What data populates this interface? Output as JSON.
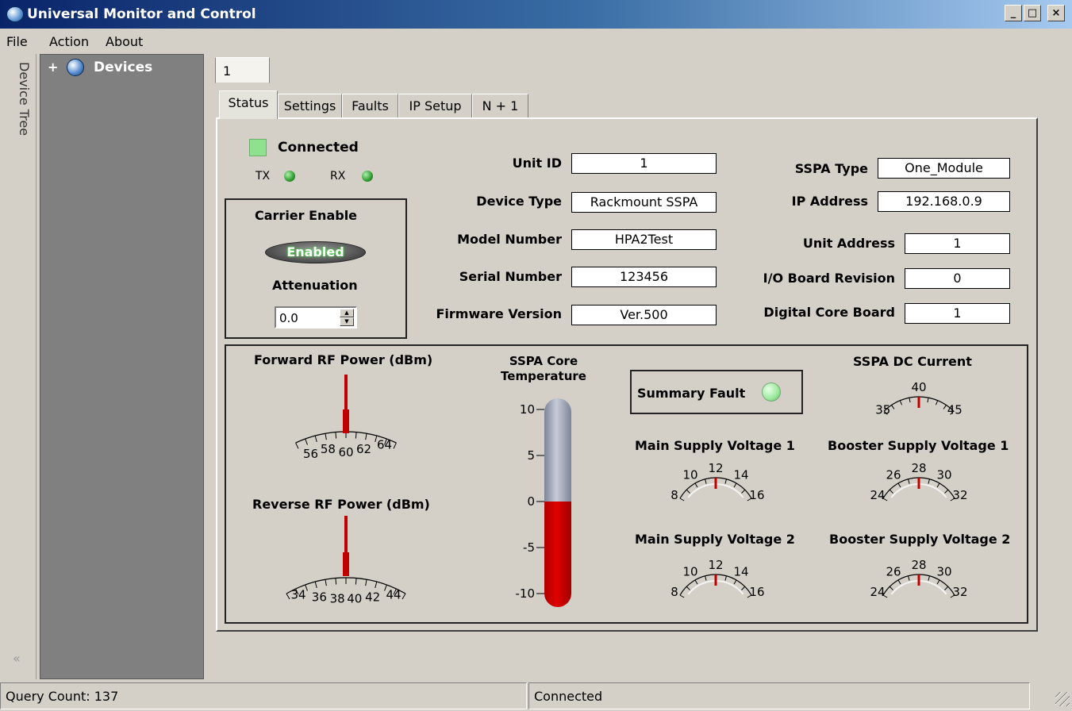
{
  "window": {
    "title": "Universal Monitor and Control",
    "controls": [
      "_",
      "□",
      "×"
    ]
  },
  "menu": {
    "file": "File",
    "action": "Action",
    "about": "About"
  },
  "sidebar": {
    "strip_label": "Device Tree",
    "collapse_glyph": "«",
    "tree_expander": "+",
    "tree_root": "Devices",
    "tree_icon": "globe-icon"
  },
  "unit_tab": {
    "label": "1"
  },
  "tabs": [
    {
      "label": "Status",
      "active": true
    },
    {
      "label": "Settings"
    },
    {
      "label": "Faults"
    },
    {
      "label": "IP Setup"
    },
    {
      "label": "N + 1"
    }
  ],
  "status": {
    "connected_label": "Connected",
    "tx_label": "TX",
    "rx_label": "RX",
    "connected_color": "#8fe08f",
    "led_color": "#2e9a2e"
  },
  "carrier": {
    "title": "Carrier Enable",
    "button_label": "Enabled",
    "attenuation_label": "Attenuation",
    "attenuation_value": "0.0"
  },
  "info_left": [
    {
      "label": "Unit ID",
      "value": "1"
    },
    {
      "label": "Device Type",
      "value": "Rackmount SSPA"
    },
    {
      "label": "Model Number",
      "value": "HPA2Test"
    },
    {
      "label": "Serial Number",
      "value": "123456"
    },
    {
      "label": "Firmware Version",
      "value": "Ver.500"
    }
  ],
  "info_right": [
    {
      "label": "SSPA Type",
      "value": "One_Module"
    },
    {
      "label": "IP Address",
      "value": "192.168.0.9"
    },
    {
      "label": "Unit Address",
      "value": "1"
    },
    {
      "label": "I/O Board Revision",
      "value": "0"
    },
    {
      "label": "Digital Core Board",
      "value": "1"
    }
  ],
  "meters": {
    "forward": {
      "title": "Forward RF Power (dBm)",
      "ticks": [
        "56",
        "58",
        "60",
        "62",
        "64"
      ],
      "min": 55,
      "max": 65,
      "value": 60
    },
    "reverse": {
      "title": "Reverse RF Power (dBm)",
      "ticks": [
        "34",
        "36",
        "38",
        "40",
        "42",
        "44"
      ],
      "min": 33,
      "max": 45,
      "value": 39
    },
    "temperature": {
      "title_line1": "SSPA Core",
      "title_line2": "Temperature",
      "ticks": [
        "10",
        "5",
        "0",
        "-5",
        "-10"
      ],
      "min": -10,
      "max": 10,
      "value": 0,
      "fill_color": "#e00000"
    },
    "summary_fault": {
      "label": "Summary Fault",
      "led_color": "#9be89b"
    },
    "dc_current": {
      "title": "SSPA DC Current",
      "ticks": [
        "35",
        "40",
        "45"
      ],
      "min": 35,
      "max": 45,
      "value": 40
    },
    "main_v1": {
      "title": "Main Supply Voltage 1",
      "ticks": [
        "8",
        "10",
        "12",
        "14",
        "16"
      ],
      "min": 8,
      "max": 16,
      "value": 12
    },
    "booster_v1": {
      "title": "Booster Supply Voltage 1",
      "ticks": [
        "24",
        "26",
        "28",
        "30",
        "32"
      ],
      "min": 24,
      "max": 32,
      "value": 28
    },
    "main_v2": {
      "title": "Main Supply Voltage 2",
      "ticks": [
        "8",
        "10",
        "12",
        "14",
        "16"
      ],
      "min": 8,
      "max": 16,
      "value": 12
    },
    "booster_v2": {
      "title": "Booster Supply Voltage 2",
      "ticks": [
        "24",
        "26",
        "28",
        "30",
        "32"
      ],
      "min": 24,
      "max": 32,
      "value": 28
    }
  },
  "statusbar": {
    "query_count": "Query Count: 137",
    "connection": "Connected"
  }
}
